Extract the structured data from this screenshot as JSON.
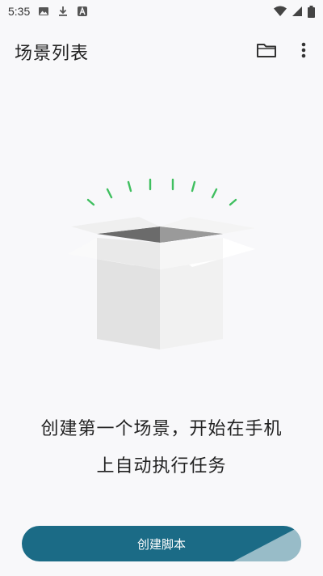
{
  "status_bar": {
    "time": "5:35",
    "icons": [
      "gallery-icon",
      "download-icon",
      "a-badge-icon",
      "wifi-icon",
      "cellular-signal-icon",
      "battery-icon"
    ]
  },
  "app_bar": {
    "title": "场景列表",
    "actions": [
      "folder-icon",
      "more-vert-icon"
    ]
  },
  "empty_state": {
    "illustration": "empty-box-icon",
    "message_line1": "创建第一个场景，开始在手机",
    "message_line2": "上自动执行任务"
  },
  "create_button": {
    "label": "创建脚本"
  },
  "colors": {
    "background": "#f8f8fa",
    "primary_button": "#1b6b86",
    "accent_rays": "#3fbf5f"
  }
}
